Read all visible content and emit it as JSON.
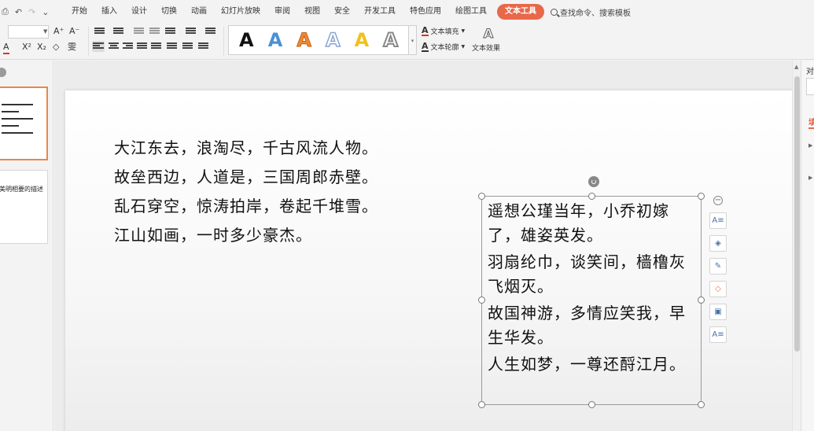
{
  "menubar": {
    "tabs": [
      {
        "label": "开始",
        "active": false
      },
      {
        "label": "插入",
        "active": false
      },
      {
        "label": "设计",
        "active": false
      },
      {
        "label": "切换",
        "active": false
      },
      {
        "label": "动画",
        "active": false
      },
      {
        "label": "幻灯片放映",
        "active": false
      },
      {
        "label": "审阅",
        "active": false
      },
      {
        "label": "视图",
        "active": false
      },
      {
        "label": "安全",
        "active": false
      },
      {
        "label": "开发工具",
        "active": false
      },
      {
        "label": "特色应用",
        "active": false
      },
      {
        "label": "绘图工具",
        "active": false
      },
      {
        "label": "文本工具",
        "active": true
      }
    ],
    "search_label": "查找命令、搜索模板",
    "accent_color": "#e8684a"
  },
  "ribbon": {
    "grow_font": "A⁺",
    "shrink_font": "A⁻",
    "font_color": "A",
    "superscript": "X²",
    "subscript": "X₂",
    "clear_format": "◇",
    "phonetic": "雯",
    "gallery_letter": "A",
    "gallery_colors": [
      "#111111",
      "#4a90d9",
      "#f08a32",
      "#8aa6d0",
      "#f3c01c",
      "#888888"
    ],
    "text_fill": "文本填充",
    "text_outline": "文本轮廓",
    "text_effect": "文本效果",
    "fill_icon": "A",
    "outline_icon": "A",
    "effect_icon": "A"
  },
  "thumbnails": {
    "slide2_text": "美明相要的描述"
  },
  "slide": {
    "poem_lines": [
      "大江东去，浪淘尽，千古风流人物。",
      "故垒西边，人道是，三国周郎赤壁。",
      "乱石穿空，惊涛拍岸，卷起千堆雪。",
      "江山如画，一时多少豪杰。"
    ],
    "textbox_paragraphs": [
      "遥想公瑾当年，小乔初嫁了，雄姿英发。",
      "羽扇纶巾，谈笑间，樯橹灰飞烟灭。",
      "故国神游，多情应笑我，早生华发。",
      "人生如梦，一尊还酹江月。"
    ]
  },
  "floatbar": {
    "collapse": "−",
    "icons": [
      "text-layout-icon",
      "layers-icon",
      "pen-icon",
      "fill-icon",
      "border-icon",
      "text-wrap-icon"
    ]
  },
  "rightpanel": {
    "label": "对",
    "tab": "填"
  }
}
